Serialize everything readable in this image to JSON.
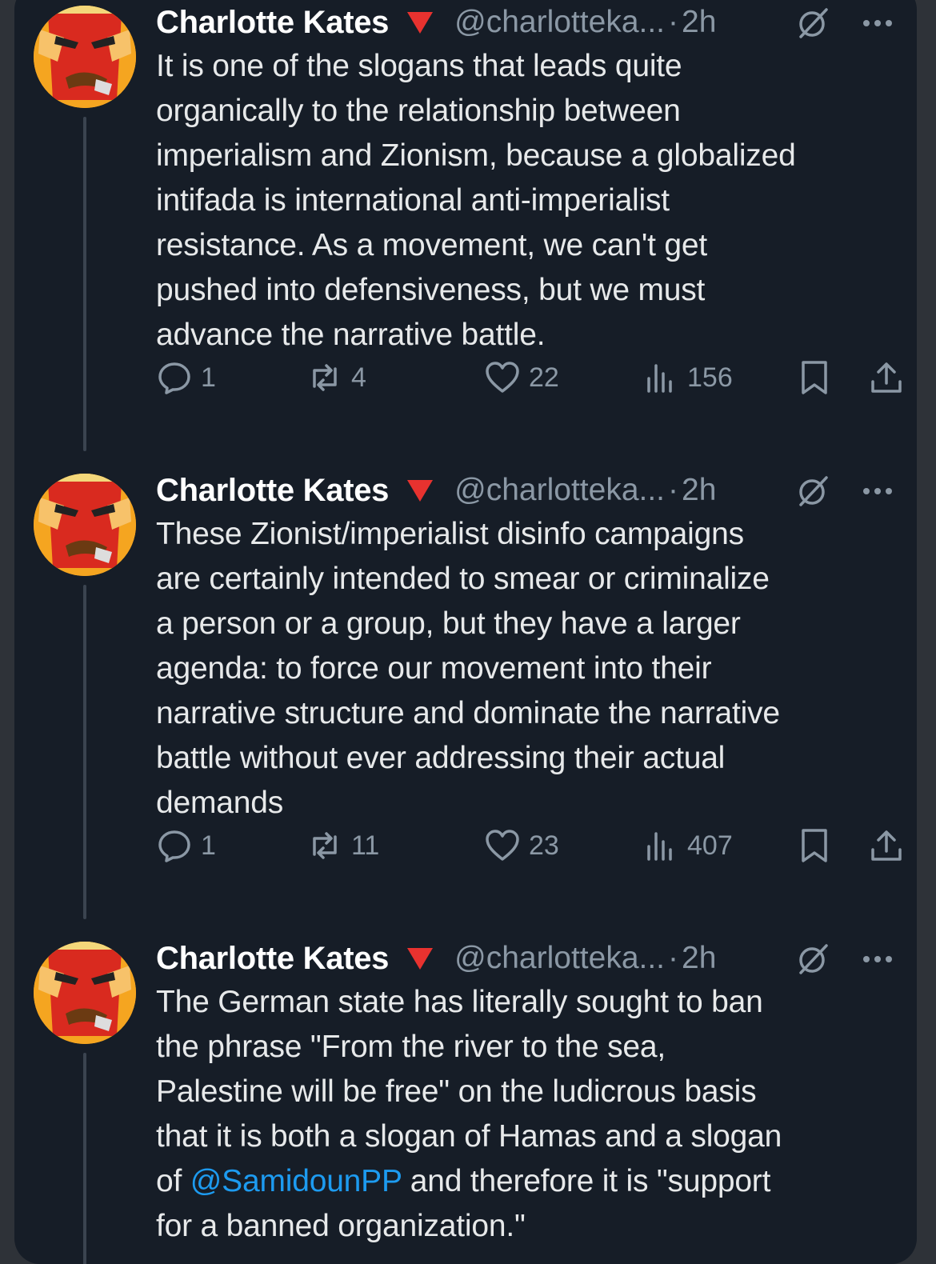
{
  "tweets": [
    {
      "author_name": "Charlotte Kates",
      "handle": "@charlotteka...",
      "separator": "·",
      "time": "2h",
      "body_lines": [
        "It is one of the slogans that leads quite",
        "organically to the relationship between",
        "imperialism and Zionism, because a globalized",
        "intifada is international anti-imperialist",
        "resistance. As a movement, we can't get",
        "pushed into defensiveness, but we must",
        "advance the narrative battle."
      ],
      "replies": "1",
      "reposts": "4",
      "likes": "22",
      "views": "156"
    },
    {
      "author_name": "Charlotte Kates",
      "handle": "@charlotteka...",
      "separator": "·",
      "time": "2h",
      "body_lines": [
        "These Zionist/imperialist disinfo campaigns",
        "are certainly intended to smear or criminalize",
        "a person or a group, but they have a larger",
        "agenda: to force our movement into their",
        "narrative structure and dominate the narrative",
        "battle without ever addressing their actual",
        "demands"
      ],
      "replies": "1",
      "reposts": "11",
      "likes": "23",
      "views": "407"
    },
    {
      "author_name": "Charlotte Kates",
      "handle": "@charlotteka...",
      "separator": "·",
      "time": "2h",
      "body_lines": [
        "The German state has literally sought to ban",
        "the phrase \"From the river to the sea,",
        "Palestine will be free\" on the ludicrous basis",
        "that it is both a slogan of Hamas and a slogan"
      ],
      "mention_line": {
        "prefix": "of ",
        "mention": "@SamidounPP",
        "suffix": " and therefore it is \"support"
      },
      "last_line": "for a banned organization.\""
    }
  ],
  "icons": {
    "flag": "red-triangle-icon",
    "grok": "grok-icon",
    "more": "more-icon",
    "reply": "reply-icon",
    "repost": "repost-icon",
    "like": "heart-icon",
    "views": "views-icon",
    "bookmark": "bookmark-icon",
    "share": "share-icon"
  },
  "colors": {
    "background": "#161d27",
    "text": "#e7e9ea",
    "muted": "#8b98a5",
    "link": "#1d9bf0",
    "flag": "#e8322f"
  }
}
